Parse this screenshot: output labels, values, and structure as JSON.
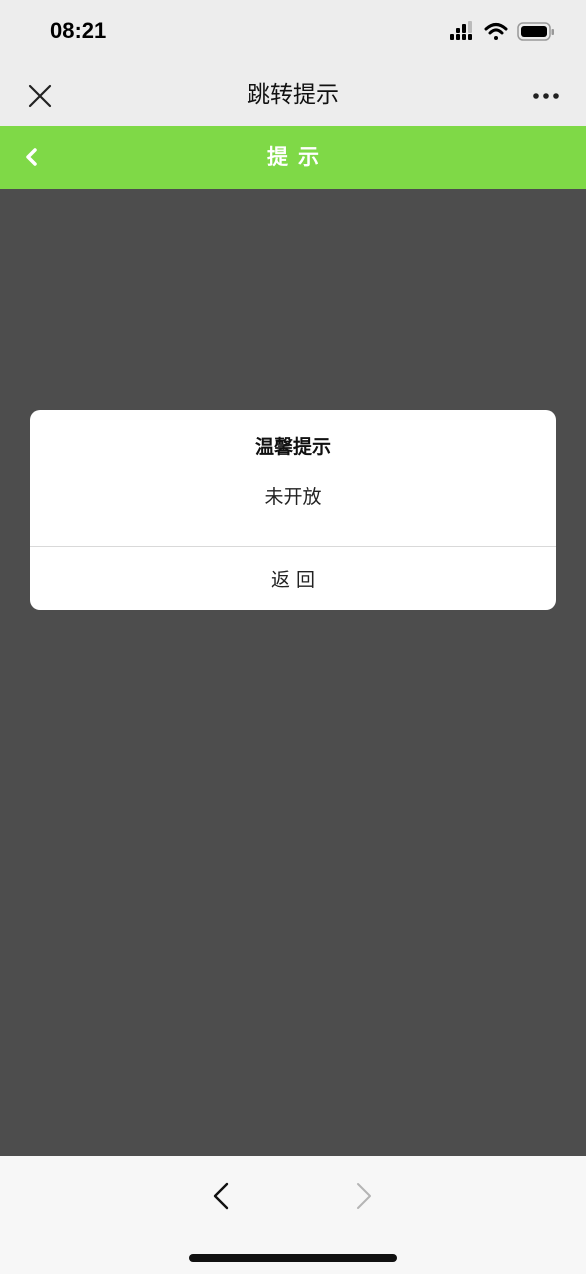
{
  "status_bar": {
    "time": "08:21"
  },
  "nav_bar": {
    "title": "跳转提示"
  },
  "header": {
    "title": "提示"
  },
  "dialog": {
    "title": "温馨提示",
    "message": "未开放",
    "button_label": "返回"
  },
  "colors": {
    "header_green": "#7fd947",
    "overlay": "#4d4d4d",
    "nav_background": "#ededed"
  },
  "icons": [
    "close-icon",
    "more-icon",
    "back-chevron-icon",
    "browser-back-icon",
    "browser-forward-icon",
    "signal-icon",
    "wifi-icon",
    "battery-icon"
  ]
}
